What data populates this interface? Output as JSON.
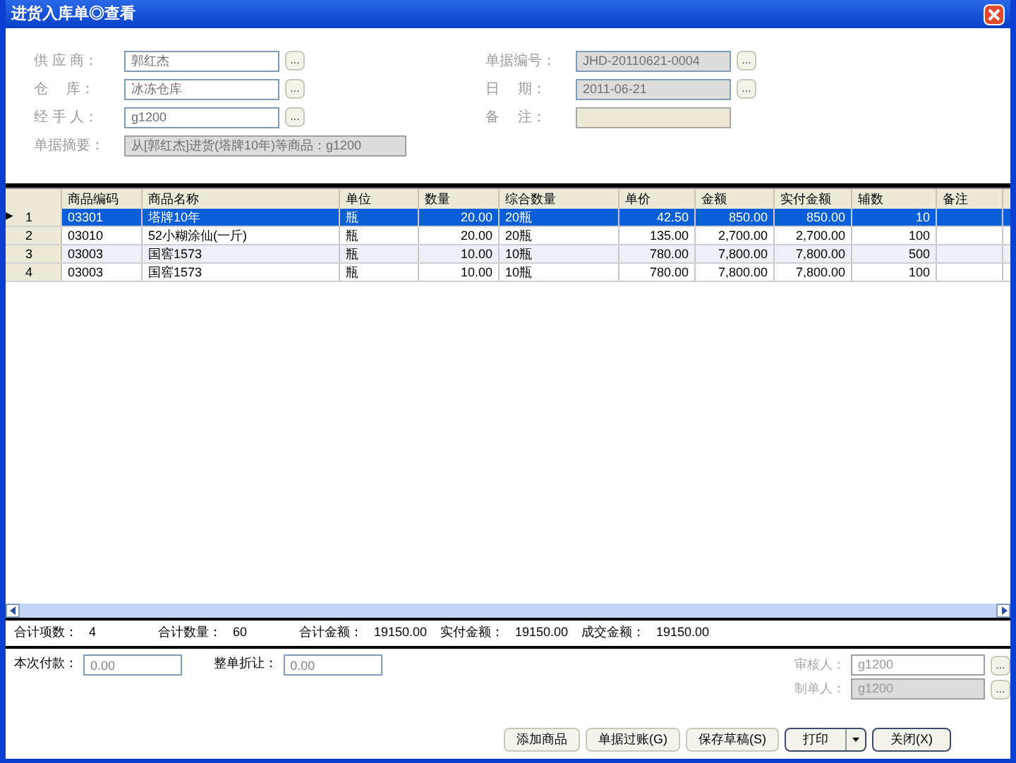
{
  "window": {
    "title": "进货入库单◎查看"
  },
  "form_left": [
    {
      "label": "供 应 商：",
      "value": "郭红杰",
      "kind": "picker"
    },
    {
      "label": "仓　 库：",
      "value": "冰冻仓库",
      "kind": "picker"
    },
    {
      "label": "经 手 人：",
      "value": "g1200",
      "kind": "picker"
    },
    {
      "label": "单据摘要：",
      "value": "从[郭红杰]进货(塔牌10年)等商品：g1200",
      "kind": "readonly"
    }
  ],
  "form_right": [
    {
      "label": "单据编号：",
      "value": "JHD-20110621-0004",
      "kind": "readonly-picker"
    },
    {
      "label": "日　 期：",
      "value": "2011-06-21",
      "kind": "readonly-picker"
    },
    {
      "label": "备　 注：",
      "kind": "note"
    }
  ],
  "table": {
    "columns": [
      "商品编码",
      "商品名称",
      "单位",
      "数量",
      "综合数量",
      "单价",
      "金额",
      "实付金额",
      "辅数",
      "备注"
    ],
    "rows": [
      {
        "index": "1",
        "selected": true,
        "cells": [
          "03301",
          "塔牌10年",
          "瓶",
          "20.00",
          "20瓶",
          "42.50",
          "850.00",
          "850.00",
          "10"
        ]
      },
      {
        "index": "2",
        "selected": false,
        "cells": [
          "03010",
          "52小糊涂仙(一斤)",
          "瓶",
          "20.00",
          "20瓶",
          "135.00",
          "2,700.00",
          "2,700.00",
          "100"
        ]
      },
      {
        "index": "3",
        "selected": false,
        "cells": [
          "03003",
          "国窖1573",
          "瓶",
          "10.00",
          "10瓶",
          "780.00",
          "7,800.00",
          "7,800.00",
          "500"
        ]
      },
      {
        "index": "4",
        "selected": false,
        "cells": [
          "03003",
          "国窖1573",
          "瓶",
          "10.00",
          "10瓶",
          "780.00",
          "7,800.00",
          "7,800.00",
          "100"
        ]
      }
    ]
  },
  "totals": [
    {
      "label": "合计项数：",
      "value": "4"
    },
    {
      "label": "合计数量：",
      "value": "60"
    },
    {
      "label": "合计金额：",
      "value": "19150.00"
    },
    {
      "label": "实付金额：",
      "value": "19150.00"
    },
    {
      "label": "成交金额：",
      "value": "19150.00"
    }
  ],
  "payment": {
    "label": "本次付款：",
    "placeholder": "0.00"
  },
  "discount": {
    "label": "整单折让：",
    "placeholder": "0.00"
  },
  "reviewer": {
    "label": "审核人：",
    "value": "g1200"
  },
  "creator": {
    "label": "制单人：",
    "value": "g1200"
  },
  "buttons": [
    "添加商品",
    "单据过账(G)",
    "保存草稿(S)"
  ],
  "print_button": "打印",
  "browse_label": "...",
  "current_row_marker": "▶",
  "close_button": "关闭(X)"
}
